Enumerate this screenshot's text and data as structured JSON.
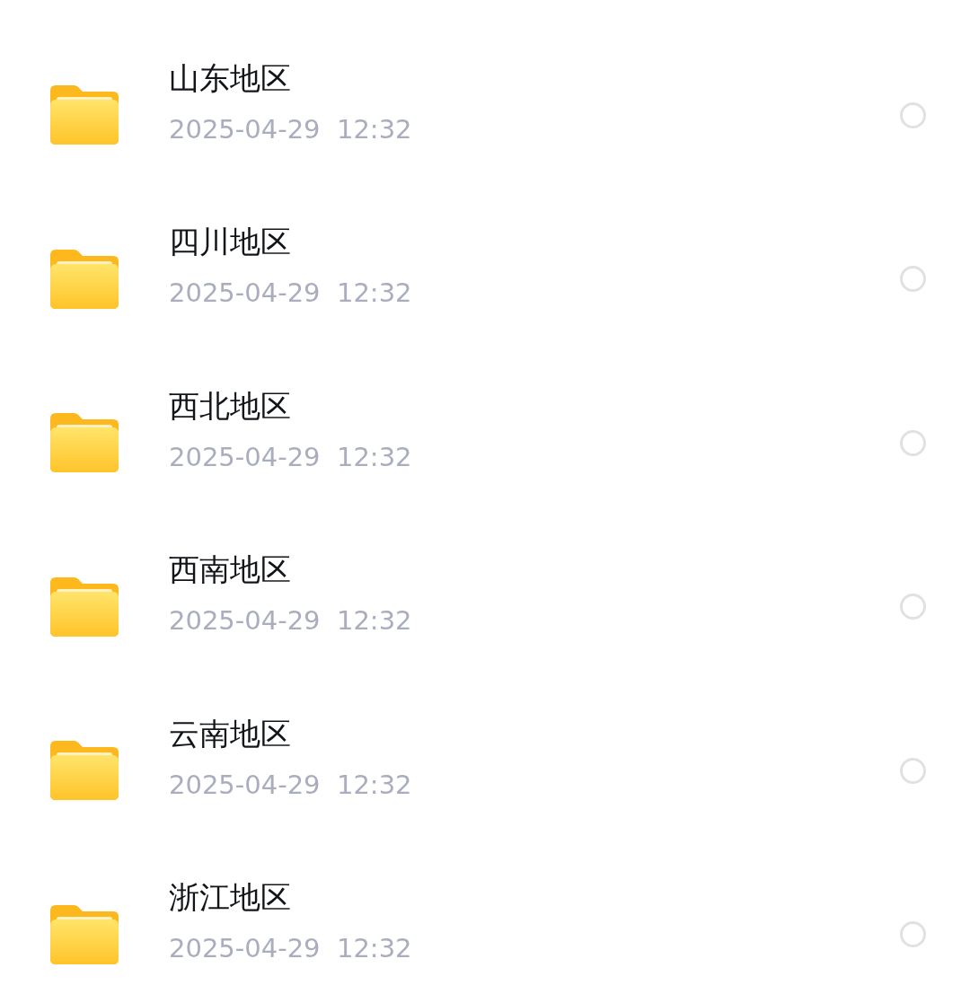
{
  "folders": [
    {
      "name": "山东地区",
      "date": "2025-04-29  12:32",
      "selected": false
    },
    {
      "name": "四川地区",
      "date": "2025-04-29  12:32",
      "selected": false
    },
    {
      "name": "西北地区",
      "date": "2025-04-29  12:32",
      "selected": false
    },
    {
      "name": "西南地区",
      "date": "2025-04-29  12:32",
      "selected": false
    },
    {
      "name": "云南地区",
      "date": "2025-04-29  12:32",
      "selected": false
    },
    {
      "name": "浙江地区",
      "date": "2025-04-29  12:32",
      "selected": false
    }
  ]
}
